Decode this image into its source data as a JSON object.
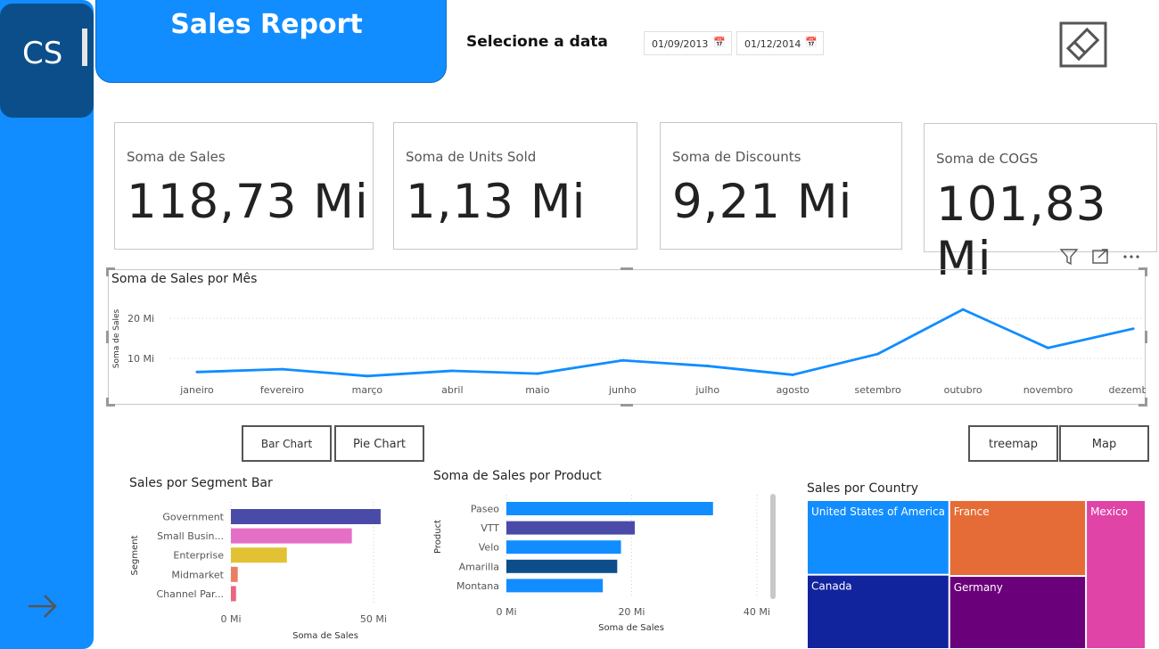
{
  "app": {
    "logo_text": "CS",
    "title": "Sales Report"
  },
  "filter": {
    "label": "Selecione a data",
    "start_date": "01/09/2013",
    "end_date": "01/12/2014"
  },
  "kpis": [
    {
      "label": "Soma de Sales",
      "value": "118,73 Mi"
    },
    {
      "label": "Soma de Units Sold",
      "value": "1,13 Mi"
    },
    {
      "label": "Soma de Discounts",
      "value": "9,21 Mi"
    },
    {
      "label": "Soma de COGS",
      "value": "101,83 Mi"
    }
  ],
  "buttons": {
    "bar_chart": "Bar Chart",
    "pie_chart": "Pie Chart",
    "treemap": "treemap",
    "map": "Map"
  },
  "icons": {
    "nav": "arrow-right-icon",
    "clear": "eraser-icon",
    "filter": "filter-icon",
    "focus": "focus-mode-icon",
    "more": "more-options-icon",
    "calendar": "calendar-icon"
  },
  "colors": {
    "accent": "#118dff",
    "dark": "#0b4e8a"
  },
  "chart_data": [
    {
      "id": "monthly",
      "type": "line",
      "title": "Soma de Sales por Mês",
      "xlabel": "",
      "ylabel": "Soma de Sales",
      "y_tick_labels": [
        "10 Mi",
        "20 Mi"
      ],
      "y_ticks": [
        10,
        20
      ],
      "ylim": [
        0,
        25
      ],
      "categories": [
        "janeiro",
        "fevereiro",
        "março",
        "abril",
        "maio",
        "junho",
        "julho",
        "agosto",
        "setembro",
        "outubro",
        "novembro",
        "dezembro"
      ],
      "values": [
        6.6,
        7.3,
        5.6,
        6.9,
        6.2,
        9.5,
        8.1,
        5.9,
        11.1,
        22.2,
        12.6,
        17.4
      ],
      "color": "#118dff",
      "grid": true
    },
    {
      "id": "segment",
      "type": "bar",
      "orientation": "horizontal",
      "title": "Sales por Segment Bar",
      "xlabel": "Soma de Sales",
      "ylabel": "Segment",
      "x_tick_labels": [
        "0 Mi",
        "50 Mi"
      ],
      "x_ticks": [
        0,
        50
      ],
      "xlim": [
        0,
        60
      ],
      "categories": [
        "Government",
        "Small Busin...",
        "Enterprise",
        "Midmarket",
        "Channel Par..."
      ],
      "values": [
        52.5,
        42.4,
        19.6,
        2.4,
        1.8
      ],
      "colors": [
        "#4a4ba8",
        "#e66fc6",
        "#e2c234",
        "#ea7e61",
        "#e86680"
      ],
      "grid": true
    },
    {
      "id": "product",
      "type": "bar",
      "orientation": "horizontal",
      "title": "Soma de Sales por Product",
      "xlabel": "Soma de Sales",
      "ylabel": "Product",
      "x_tick_labels": [
        "0 Mi",
        "20 Mi",
        "40 Mi"
      ],
      "x_ticks": [
        0,
        20,
        40
      ],
      "xlim": [
        0,
        42
      ],
      "categories": [
        "Paseo",
        "VTT",
        "Velo",
        "Amarilla",
        "Montana"
      ],
      "values": [
        33.0,
        20.5,
        18.3,
        17.7,
        15.4
      ],
      "colors": [
        "#118dff",
        "#4a4ba8",
        "#118dff",
        "#0b4e8a",
        "#118dff"
      ],
      "grid": true
    },
    {
      "id": "country",
      "type": "treemap",
      "title": "Sales por Country",
      "categories": [
        "United States of America",
        "France",
        "Mexico",
        "Canada",
        "Germany"
      ],
      "values": [
        25.0,
        24.4,
        20.9,
        24.9,
        23.5
      ],
      "colors": [
        "#118dff",
        "#e66c37",
        "#e044a7",
        "#12239e",
        "#6b007b"
      ]
    }
  ]
}
